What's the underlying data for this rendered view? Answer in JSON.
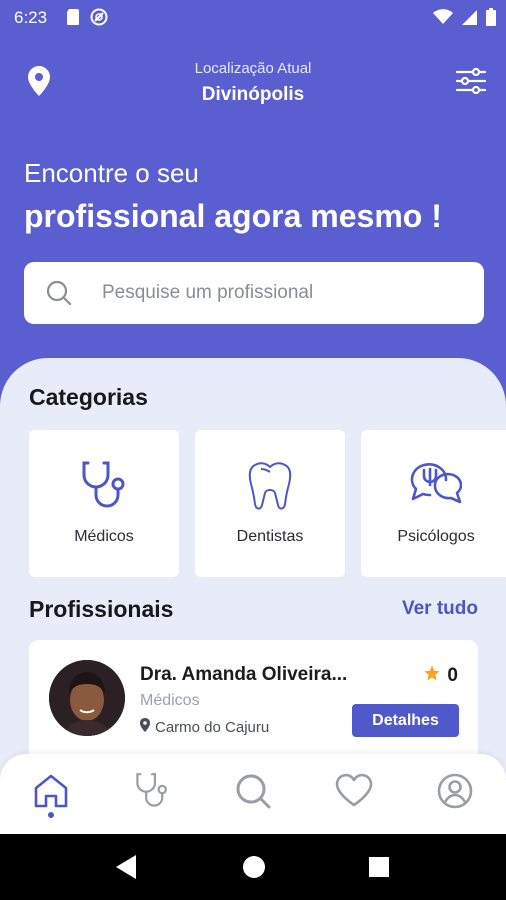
{
  "status_bar": {
    "time": "6:23"
  },
  "header": {
    "location_label": "Localização Atual",
    "location_city": "Divinópolis"
  },
  "hero": {
    "line1": "Encontre o seu",
    "line2": "profissional agora mesmo !"
  },
  "search": {
    "placeholder": "Pesquise um profissional"
  },
  "categories": {
    "title": "Categorias",
    "items": [
      {
        "label": "Médicos",
        "icon": "stethoscope-icon"
      },
      {
        "label": "Dentistas",
        "icon": "tooth-icon"
      },
      {
        "label": "Psicólogos",
        "icon": "psychology-chat-icon"
      }
    ]
  },
  "professionals": {
    "title": "Profissionais",
    "see_all": "Ver tudo",
    "items": [
      {
        "name": "Dra. Amanda Oliveira...",
        "specialty": "Médicos",
        "location": "Carmo do Cajuru",
        "rating": "0",
        "details_label": "Detalhes"
      }
    ]
  },
  "bottom_nav": {
    "active": "home",
    "items": [
      "home-icon",
      "stethoscope-icon",
      "search-icon",
      "heart-icon",
      "profile-icon"
    ]
  },
  "colors": {
    "primary": "#5A5ED1",
    "accent": "#4E55C9",
    "sheet_bg": "#E7ECF8",
    "star": "#F5A623"
  }
}
